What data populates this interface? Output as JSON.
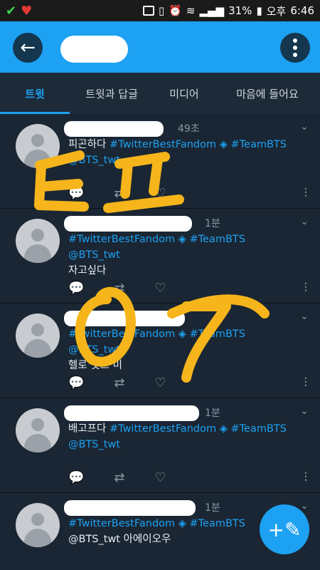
{
  "status": {
    "battery": "31%",
    "ampm": "오후",
    "clock": "6:46"
  },
  "header": {
    "back_icon": "back-arrow-icon",
    "more_icon": "more-vertical-icon"
  },
  "tabs": [
    "트윗",
    "트윗과 답글",
    "미디어",
    "마음에 들어요"
  ],
  "tweets": [
    {
      "time": "49초",
      "text": "피곤하다 ",
      "tags": "#TwitterBestFandom ◈ #TeamBTS",
      "line2": "@BTS_twt"
    },
    {
      "time": "1분",
      "text": "",
      "tags": "#TwitterBestFandom ◈ #TeamBTS @BTS_twt",
      "line2": "자고싶다"
    },
    {
      "time": "",
      "text": "",
      "tags": "#TwitterBestFandom ◈ #TeamBTS @BTS_twt",
      "line2": "헬로 잇츠 미"
    },
    {
      "time": "1분",
      "text": "배고프다 ",
      "tags": "#TwitterBestFandom ◈ #TeamBTS",
      "line2": "@BTS_twt"
    },
    {
      "time": "1분",
      "text": "",
      "tags": "#TwitterBestFandom ◈ #TeamBTS",
      "line2": "@BTS_twt 아에이오우"
    }
  ],
  "colors": {
    "accent": "#1da1f2",
    "bg": "#15202b",
    "scribble": "#f5b51b"
  }
}
